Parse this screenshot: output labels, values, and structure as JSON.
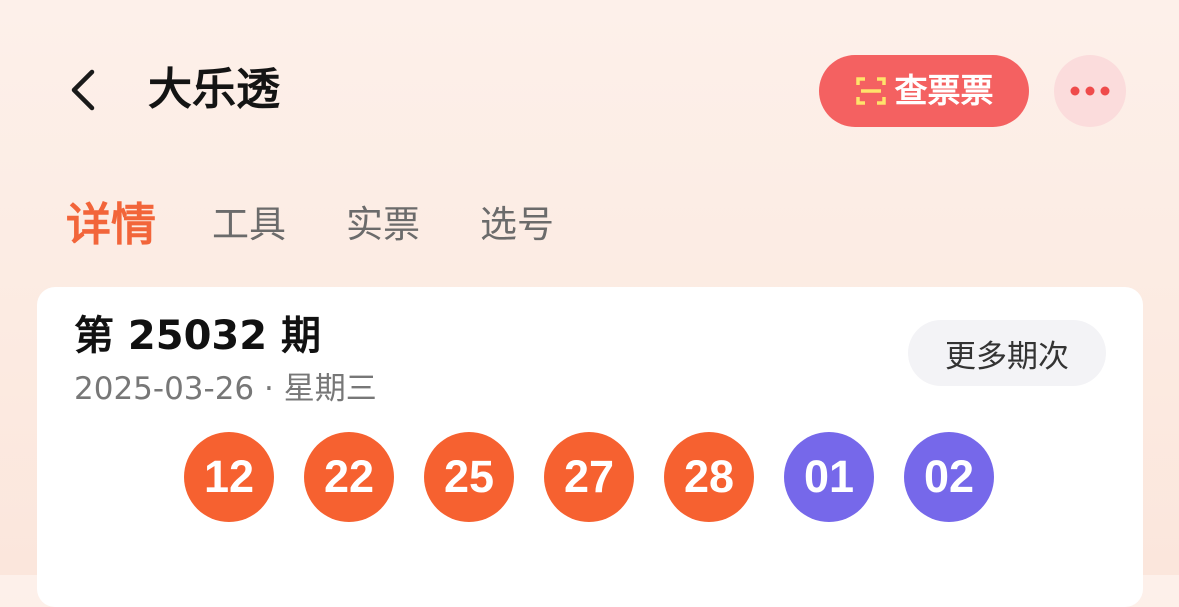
{
  "header": {
    "title": "大乐透",
    "check_ticket_label": "查票票"
  },
  "tabs": [
    {
      "label": "详情",
      "active": true
    },
    {
      "label": "工具",
      "active": false
    },
    {
      "label": "实票",
      "active": false
    },
    {
      "label": "选号",
      "active": false
    }
  ],
  "draw": {
    "issue": "第 25032 期",
    "date": "2025-03-26 · 星期三",
    "more_issues_label": "更多期次",
    "front_numbers": [
      "12",
      "22",
      "25",
      "27",
      "28"
    ],
    "back_numbers": [
      "01",
      "02"
    ]
  },
  "colors": {
    "accent": "#f2653a",
    "check_button": "#f46161",
    "front_ball": "#f66130",
    "back_ball": "#7668ea"
  },
  "icons": {
    "back": "chevron-left-icon",
    "scan": "scan-icon",
    "more": "ellipsis-icon"
  }
}
